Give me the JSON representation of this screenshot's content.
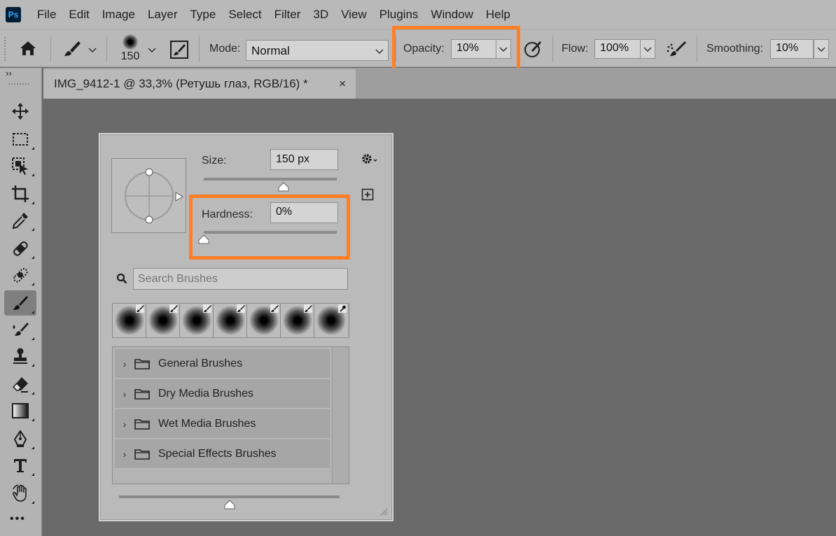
{
  "app": {
    "logo": "Ps",
    "menu": [
      "File",
      "Edit",
      "Image",
      "Layer",
      "Type",
      "Select",
      "Filter",
      "3D",
      "View",
      "Plugins",
      "Window",
      "Help"
    ]
  },
  "options_bar": {
    "brush_size": "150",
    "mode_label": "Mode:",
    "mode_value": "Normal",
    "opacity_label": "Opacity:",
    "opacity_value": "10%",
    "flow_label": "Flow:",
    "flow_value": "100%",
    "smoothing_label": "Smoothing:",
    "smoothing_value": "10%"
  },
  "document_tab": {
    "title": "IMG_9412-1 @ 33,3% (Ретушь глаз, RGB/16) *",
    "close": "×"
  },
  "toolbar": {
    "collapse": "››",
    "more": "•••"
  },
  "brush_panel": {
    "size_label": "Size:",
    "size_value": "150 px",
    "size_level": 0.6,
    "hardness_label": "Hardness:",
    "hardness_value": "0%",
    "hardness_level": 0.0,
    "search_placeholder": "Search Brushes",
    "preview_slider_level": 0.5,
    "folders": [
      {
        "label": "General Brushes"
      },
      {
        "label": "Dry Media Brushes"
      },
      {
        "label": "Wet Media Brushes"
      },
      {
        "label": "Special Effects Brushes"
      }
    ]
  },
  "colors": {
    "highlight": "#ff7f27",
    "chrome": "#b9b9b9",
    "canvas": "#6a6a6a",
    "ps_logo_bg": "#001e36",
    "ps_logo_fg": "#31a8ff"
  }
}
